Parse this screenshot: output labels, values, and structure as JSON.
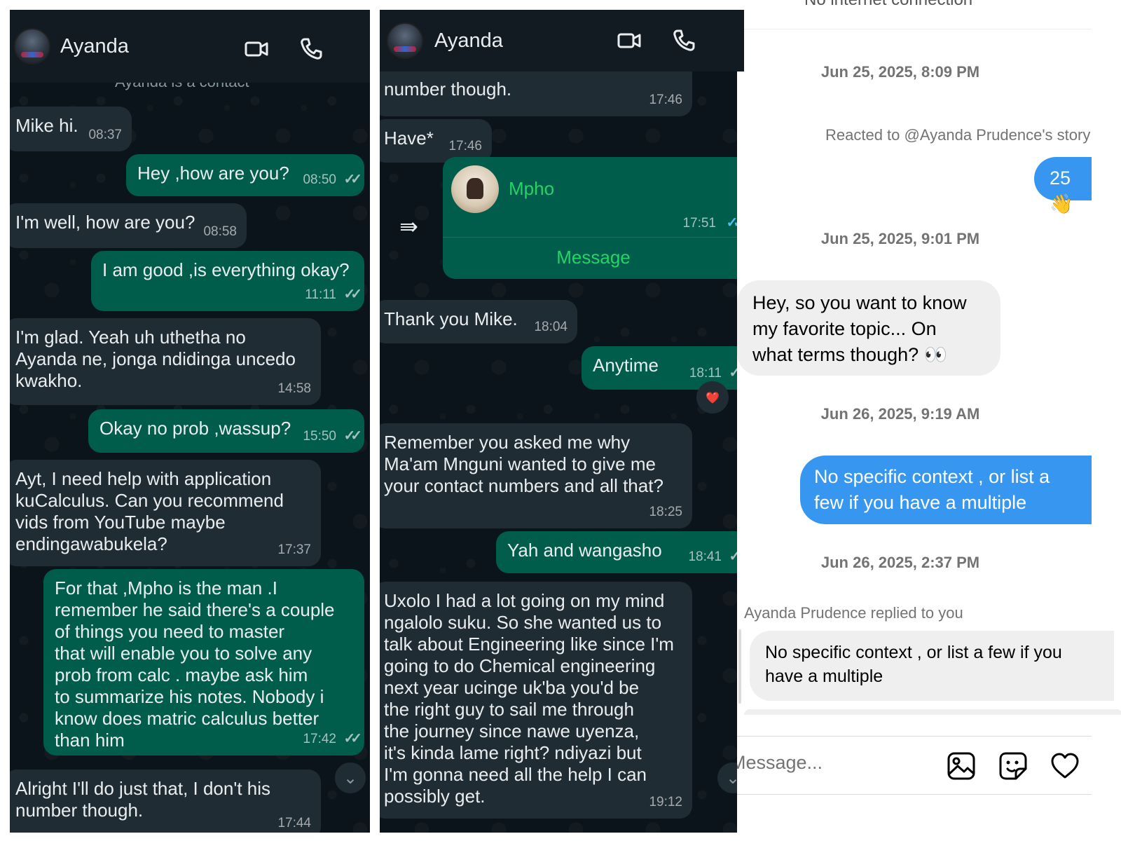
{
  "whatsapp_1": {
    "contact_name": "Ayanda",
    "sub_header": "Ayanda is a contact",
    "messages": [
      {
        "text": "Mike hi.",
        "time": "08:37",
        "dir": "in"
      },
      {
        "text": "Hey ,how are you?",
        "time": "08:50",
        "dir": "out"
      },
      {
        "text": "I'm well, how are you?",
        "time": "08:58",
        "dir": "in"
      },
      {
        "text": "I am good ,is everything okay?",
        "time": "11:11",
        "dir": "out"
      },
      {
        "text": "I'm glad. Yeah uh uthetha no\nAyanda ne, jonga ndidinga uncedo\nkwakho.",
        "time": "14:58",
        "dir": "in"
      },
      {
        "text": "Okay no prob ,wassup?",
        "time": "15:50",
        "dir": "out"
      },
      {
        "text": "Ayt, I need help with application\nkuCalculus. Can you recommend\nvids from YouTube maybe\nendingawabukela?",
        "time": "17:37",
        "dir": "in"
      },
      {
        "text": "For that ,Mpho is the man .I\nremember he said there's a couple\nof things you need to master\nthat will enable you to solve any\nprob from calc . maybe ask him\nto summarize his notes. Nobody i\nknow does matric calculus better\nthan him",
        "time": "17:42",
        "dir": "out"
      },
      {
        "text": "Alright I'll do just that, I don't his\nnumber though.",
        "time": "17:44",
        "dir": "in"
      }
    ]
  },
  "whatsapp_2": {
    "contact_name": "Ayanda",
    "messages": [
      {
        "text": "number though.",
        "time": "17:46",
        "dir": "in"
      },
      {
        "text": "Have*",
        "time": "17:46",
        "dir": "in"
      },
      {
        "text": "Thank you Mike.",
        "time": "18:04",
        "dir": "in"
      },
      {
        "text": "Anytime",
        "time": "18:11",
        "dir": "out"
      },
      {
        "text": "Remember you asked me why\nMa'am Mnguni wanted to give me\nyour contact numbers and all that?",
        "time": "18:25",
        "dir": "in"
      },
      {
        "text": "Yah and wangasho",
        "time": "18:41",
        "dir": "out"
      },
      {
        "text": "Uxolo I had a lot going on my mind\nngalolo suku. So she wanted us to\ntalk about Engineering like since I'm\ngoing to do Chemical engineering\nnext year ucinge uk'ba you'd be\nthe right guy to sail me through\nthe journey since nawe uyenza,\nit's kinda lame right? ndiyazi but\nI'm gonna need all the help I can\npossibly get.",
        "time": "19:12",
        "dir": "in"
      }
    ],
    "contact_card": {
      "name": "Mpho",
      "time": "17:51",
      "action": "Message"
    },
    "reaction": "❤️"
  },
  "instagram": {
    "top_banner": "No internet connection",
    "date_1": "Jun 25, 2025, 8:09 PM",
    "story_note": "Reacted to @Ayanda Prudence's story",
    "story_reaction": "25 👋",
    "date_2": "Jun 25, 2025, 9:01 PM",
    "msg_in_1": "Hey, so you want to know\nmy favorite topic... On\nwhat terms though? 👀",
    "date_3": "Jun 26, 2025, 9:19 AM",
    "msg_out_1": "No specific context , or list a\nfew if you have a multiple",
    "date_4": "Jun 26, 2025, 2:37 PM",
    "reply_note": "Ayanda Prudence replied to you",
    "reply_quote": "No specific context , or list a few if you\nhave a multiple",
    "input_placeholder": "Message..."
  },
  "colors": {
    "wa_bg": "#0b141a",
    "wa_header": "#121b22",
    "wa_incoming": "#202c33",
    "wa_outgoing": "#005c4b",
    "wa_accent": "#25d366",
    "wa_ticks": "#53bdeb",
    "ig_blue": "#3797f0",
    "ig_gray_bubble": "#efefef"
  },
  "icons": [
    "video-call-icon",
    "voice-call-icon",
    "forward-icon",
    "scroll-down-icon",
    "image-icon",
    "sticker-icon",
    "heart-icon"
  ]
}
